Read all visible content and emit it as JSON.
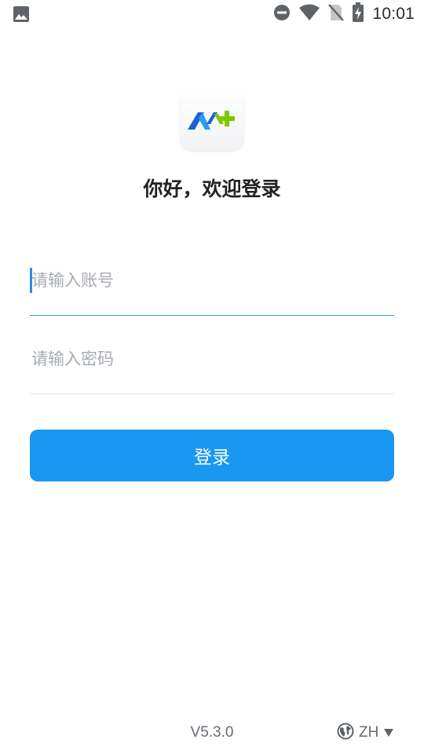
{
  "status_bar": {
    "time": "10:01"
  },
  "welcome": {
    "title": "你好，欢迎登录"
  },
  "form": {
    "account_placeholder": "请输入账号",
    "account_value": "",
    "password_placeholder": "请输入密码",
    "password_value": "",
    "login_label": "登录"
  },
  "footer": {
    "version": "V5.3.0",
    "language": "ZH"
  },
  "colors": {
    "primary": "#1a97f0",
    "logo_blue": "#1f5fd6",
    "logo_green": "#7ac800",
    "placeholder": "#a7abb1"
  },
  "icons": {
    "status_left": "image-icon",
    "status_right": [
      "do-not-disturb-icon",
      "wifi-icon",
      "no-sim-icon",
      "battery-charging-icon"
    ],
    "language": "globe-icon",
    "language_caret": "caret-down-icon"
  }
}
